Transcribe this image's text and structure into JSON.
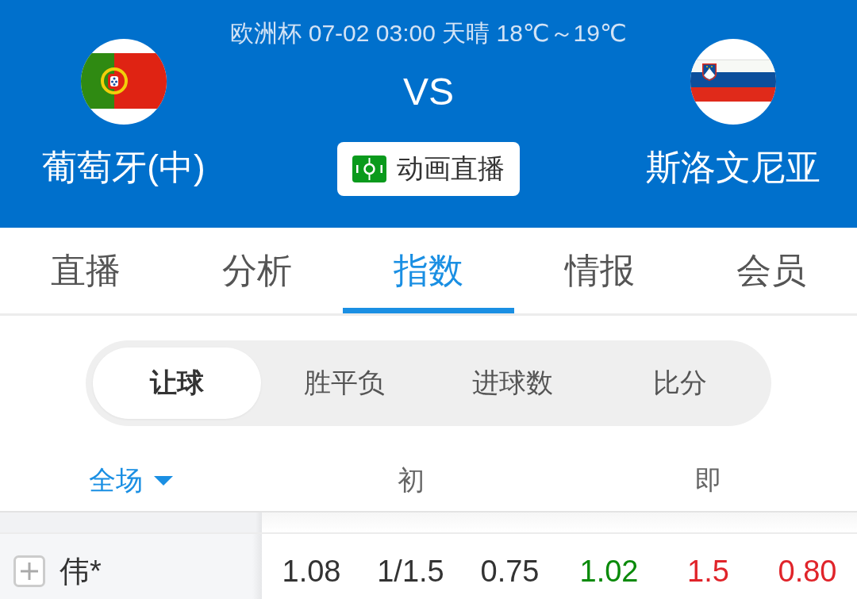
{
  "header": {
    "match_info": "欧洲杯 07-02 03:00 天晴 18℃～19℃",
    "home_team": {
      "name": "葡萄牙(中)"
    },
    "vs": "VS",
    "away_team": {
      "name": "斯洛文尼亚"
    },
    "animation_button": {
      "label": "动画直播"
    }
  },
  "tabs": [
    {
      "label": "直播",
      "selected": false
    },
    {
      "label": "分析",
      "selected": false
    },
    {
      "label": "指数",
      "selected": true
    },
    {
      "label": "情报",
      "selected": false
    },
    {
      "label": "会员",
      "selected": false
    }
  ],
  "bet_types": [
    {
      "label": "让球",
      "selected": true
    },
    {
      "label": "胜平负",
      "selected": false
    },
    {
      "label": "进球数",
      "selected": false
    },
    {
      "label": "比分",
      "selected": false
    }
  ],
  "odds_table": {
    "period_filter": {
      "label": "全场"
    },
    "columns": [
      {
        "label": "初"
      },
      {
        "label": "即"
      }
    ],
    "rows": [
      {
        "company": "伟*",
        "expanded": false,
        "values": [
          {
            "text": "1.08",
            "color": "#333333"
          },
          {
            "text": "1/1.5",
            "color": "#333333"
          },
          {
            "text": "0.75",
            "color": "#333333"
          },
          {
            "text": "1.02",
            "color": "#0a8a0a"
          },
          {
            "text": "1.5",
            "color": "#e0242a"
          },
          {
            "text": "0.80",
            "color": "#e0242a"
          }
        ]
      }
    ]
  }
}
